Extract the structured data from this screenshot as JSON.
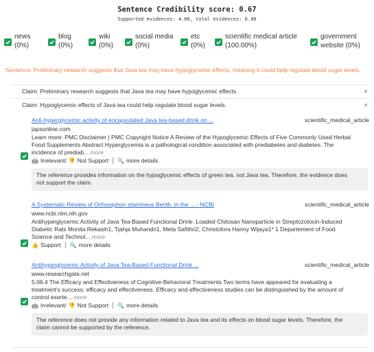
{
  "score": {
    "title": "Sentence Credibility score: 0.67",
    "subtitle": "Supported evidences: 4.00, total evidences: 6.00"
  },
  "filters": [
    {
      "label": "news",
      "pct": "(0%)",
      "checked": true
    },
    {
      "label": "blog",
      "pct": "(0%)",
      "checked": true
    },
    {
      "label": "wiki",
      "pct": "(0%)",
      "checked": true
    },
    {
      "label": "social media",
      "pct": "(0%)",
      "checked": true
    },
    {
      "label": "etc",
      "pct": "(0%)",
      "checked": true
    },
    {
      "label": "scientific medical article",
      "pct": "(100.00%)",
      "checked": true
    },
    {
      "label": "government",
      "pct": "website (0%)",
      "checked": true
    }
  ],
  "sentence": "Sentence: Preliminary research suggests that Java tea may have hypoglycemic effects, meaning it could help regulate blood sugar levels.",
  "claims": [
    {
      "text": "Claim: Preliminary research suggests that Java tea may have hypoglycemic effects.",
      "chevron": "˅"
    },
    {
      "text": "Claim: Hypoglycemic effects of Java tea could help regulate blood sugar levels.",
      "chevron": "˄"
    }
  ],
  "evidences": [
    {
      "title": "Anti-hyperglycemic activity of encapsulated Java tea-based drink on ...",
      "type": "scientific_medical_article",
      "domain": "japsonline.com",
      "snippet_lines": [
        "Learn more: PMC Disclaimer | PMC Copyright Notice A Review of the Hypoglycemic Effects of Five Commonly Used Herbal",
        "Food Supplements Abstract Hyperglycemia is a pathological condition associated with prediabetes and diabetes. The",
        "incidence of prediab..."
      ],
      "more": "more",
      "label": "Irrelevant/",
      "stance": "Not Support",
      "details": "more details",
      "explanation_lines": [
        "The reference provides information on the hypoglycemic effects of green tea, not Java tea. Therefore, the evidence does",
        "not support the claim."
      ]
    },
    {
      "title": "A Systematic Review of Orthosiphon stamineus Benth. in the ... - NCBI",
      "type": "scientific_medical_article",
      "domain": "www.ncbi.nlm.nih.gov",
      "snippet_lines": [
        "Antihyperglycemic Activity of Java Tea-Based Functional Drink- Loaded Chitosan Nanoparticle in Streptozotocin-Induced",
        "Diabetic Rats Monita Rekasih1, Tjahja Muhandri1, Meta Safithri2, Christofora Hanny Wijaya1* 1 Departement of Food",
        "Science and Technol..."
      ],
      "more": "more",
      "stance": "Support",
      "details": "more details"
    },
    {
      "title": "Antihyperglycemic Activity of Java Tea-Based Functional Drink ...",
      "type": "scientific_medical_article",
      "domain": "www.researchgate.net",
      "snippet_lines": [
        "5.06.4 The Efficacy and Effectiveness of Cognitive-Behavioral Treatments Two terms have appeared for evaluating a",
        "treatment's success: efficacy and effectiveness. Efficacy and effectiveness studies can be distinguished by the amount of",
        "control exerte..."
      ],
      "more": "more",
      "label": "Irrelevant/",
      "stance": "Not Support",
      "details": "more details",
      "explanation_lines": [
        "The reference does not provide any information related to Java tea and its effects on blood sugar levels. Therefore, the",
        "claim cannot be supported by the reference."
      ]
    }
  ],
  "colors": {
    "accent_green": "#1e9e55",
    "sentence_orange": "#f07f3c",
    "link_blue": "#2f6bd9"
  }
}
